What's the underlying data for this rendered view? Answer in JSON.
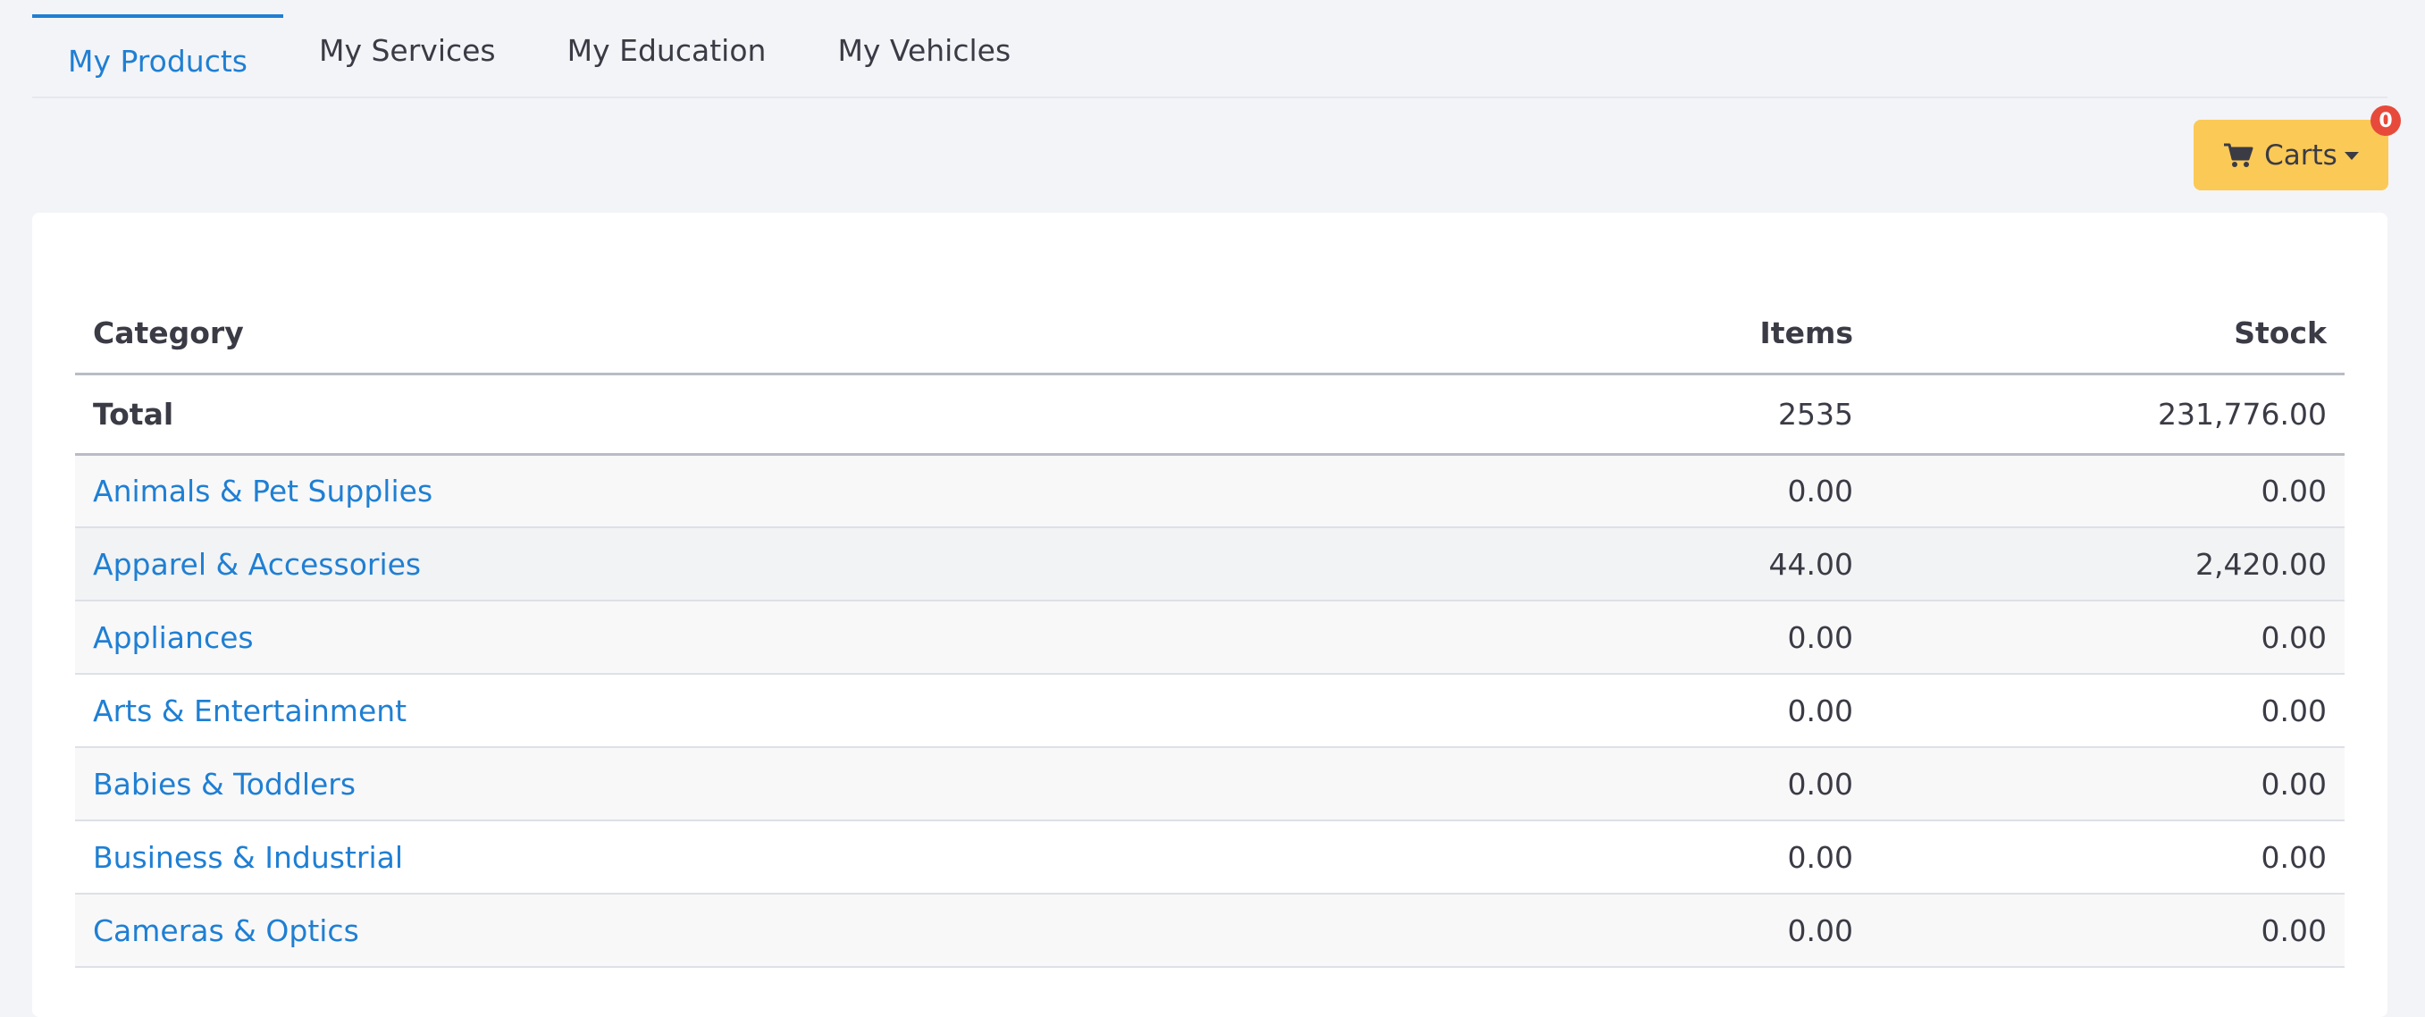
{
  "tabs": [
    {
      "label": "My Products",
      "active": true
    },
    {
      "label": "My Services",
      "active": false
    },
    {
      "label": "My Education",
      "active": false
    },
    {
      "label": "My Vehicles",
      "active": false
    }
  ],
  "carts": {
    "label": "Carts",
    "badge": "0",
    "icon": "shopping-cart-icon",
    "color": "#fbc956",
    "badge_color": "#e74a3b"
  },
  "table": {
    "headers": {
      "category": "Category",
      "items": "Items",
      "stock": "Stock"
    },
    "total": {
      "label": "Total",
      "items": "2535",
      "stock": "231,776.00"
    },
    "rows": [
      {
        "category": "Animals & Pet Supplies",
        "items": "0.00",
        "stock": "0.00"
      },
      {
        "category": "Apparel & Accessories",
        "items": "44.00",
        "stock": "2,420.00"
      },
      {
        "category": "Appliances",
        "items": "0.00",
        "stock": "0.00"
      },
      {
        "category": "Arts & Entertainment",
        "items": "0.00",
        "stock": "0.00"
      },
      {
        "category": "Babies & Toddlers",
        "items": "0.00",
        "stock": "0.00"
      },
      {
        "category": "Business & Industrial",
        "items": "0.00",
        "stock": "0.00"
      },
      {
        "category": "Cameras & Optics",
        "items": "0.00",
        "stock": "0.00"
      }
    ]
  },
  "colors": {
    "accent": "#1f7fd3",
    "background": "#f3f4f7"
  }
}
